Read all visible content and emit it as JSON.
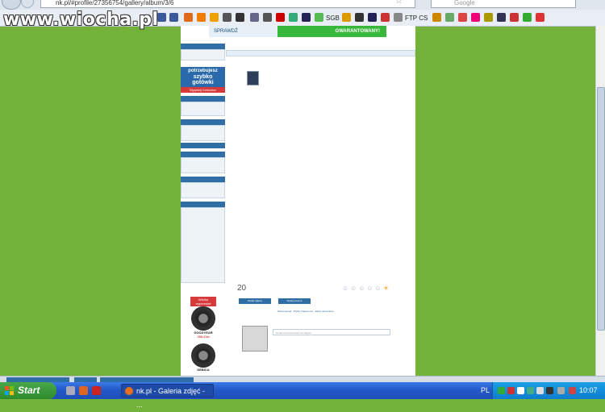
{
  "browser": {
    "url": "nk.pl/#profile/27356754/gallery/album/3/6",
    "search_placeholder": "Google",
    "bookmark_labels": [
      "SGB",
      "FTP CS"
    ]
  },
  "watermark": "www.wiocha.pl",
  "page": {
    "banner_left": "SPRAWDŹ",
    "banner_right": "GWARANTOWANY!",
    "ad_text": [
      "potrzebujesz",
      "szybko",
      "gotówki"
    ],
    "ad_button": "Wypełnij formularz",
    "stats_number": "20",
    "action_buttons": [
      "Wyślij zdjęcie",
      "Wyślij prezent"
    ],
    "links": [
      "Pełna wersja",
      "Wyślij znajomemu",
      "Zgłoś naruszenie"
    ],
    "comment_placeholder": "Dodaj swój komentarz do zdjęcia",
    "tire_ad": {
      "badge": "Wielka wyprzedaż",
      "brand": "GOODYEAR",
      "price": "286,43zł",
      "brand2": "DEBICA"
    }
  },
  "taskbar": {
    "start_label": "Start",
    "task_item": "nk.pl - Galeria zdjęć - ...",
    "language": "PL",
    "clock": "10:07"
  },
  "colors": {
    "desktop_green": "#73b33a",
    "nk_blue": "#2f6fa5",
    "xp_taskbar": "#2458c8"
  }
}
